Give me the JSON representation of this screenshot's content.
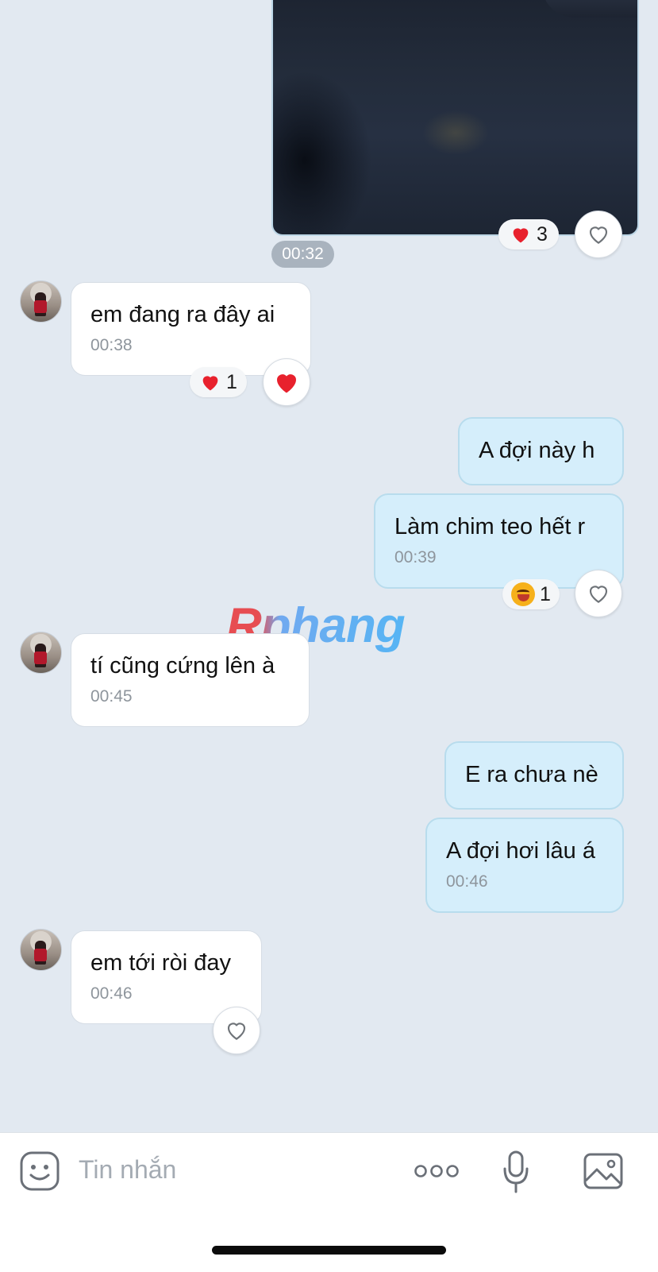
{
  "photo_message": {
    "time": "00:32",
    "reaction_count": "3",
    "reaction_emoji": "heart-red"
  },
  "messages": [
    {
      "side": "in",
      "text": "em đang ra đây ai",
      "time": "00:38",
      "reaction_count": "1",
      "reaction_emoji": "heart-red",
      "like_state": "liked"
    },
    {
      "side": "out",
      "text": "A đợi này h",
      "time": ""
    },
    {
      "side": "out",
      "text": "Làm chim teo hết r",
      "time": "00:39",
      "reaction_count": "1",
      "reaction_emoji": "laughing-face",
      "like_state": "empty"
    },
    {
      "side": "in",
      "text": "tí cũng cứng lên à",
      "time": "00:45"
    },
    {
      "side": "out",
      "text": "E ra chưa nè",
      "time": ""
    },
    {
      "side": "out",
      "text": "A đợi hơi lâu á",
      "time": "00:46"
    },
    {
      "side": "in",
      "text": "em tới ròi đay",
      "time": "00:46",
      "like_state": "empty"
    }
  ],
  "watermark": "Rphang",
  "composer": {
    "placeholder": "Tin nhắn",
    "icons": [
      "sticker-icon",
      "more-icon",
      "microphone-icon",
      "gallery-icon"
    ]
  },
  "colors": {
    "background": "#e2e9f1",
    "outgoing_bubble": "#d5eefb",
    "incoming_bubble": "#ffffff",
    "heart": "#e8212d"
  }
}
